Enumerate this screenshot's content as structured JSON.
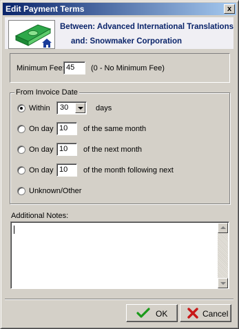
{
  "window": {
    "title": "Edit Payment Terms",
    "close_symbol": "x"
  },
  "header": {
    "between_label": "Between: Advanced International Translations",
    "and_label": "and:  Snowmaker Corporation",
    "logo_icon": "money-house-icon"
  },
  "minimum_fee": {
    "label": "Minimum Fee:",
    "value": "45",
    "hint": "(0 - No Minimum Fee)"
  },
  "invoice_group": {
    "caption": "From Invoice Date",
    "options": [
      {
        "label": "Within",
        "value": "30",
        "suffix": "days",
        "checked": true
      },
      {
        "label": "On day",
        "value": "10",
        "suffix": "of the same month",
        "checked": false
      },
      {
        "label": "On day",
        "value": "10",
        "suffix": "of the next month",
        "checked": false
      },
      {
        "label": "On day",
        "value": "10",
        "suffix": "of the month following next",
        "checked": false
      },
      {
        "label": "Unknown/Other",
        "checked": false
      }
    ]
  },
  "notes": {
    "label": "Additional Notes:",
    "value": ""
  },
  "buttons": {
    "ok_label": "OK",
    "ok_icon": "checkmark-icon",
    "cancel_label": "Cancel",
    "cancel_icon": "x-mark-icon"
  },
  "colors": {
    "title_start": "#0a246a",
    "title_end": "#a6caf0",
    "header_text": "#0a246a",
    "ok_green": "#1a9a1a",
    "cancel_red": "#c81818"
  }
}
